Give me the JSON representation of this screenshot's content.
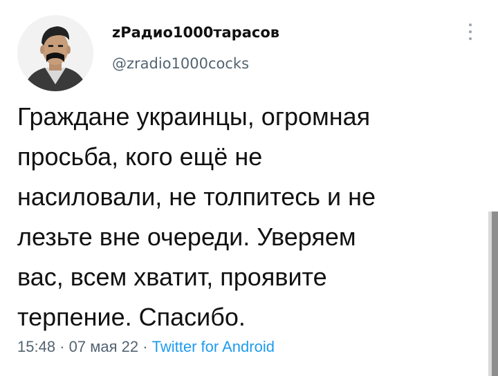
{
  "author": {
    "display_name": "zРадио1000тарасов",
    "handle": "@zradio1000cocks"
  },
  "tweet": {
    "text": "Граждане украинцы, огромная\nпросьба, кого ещё не\nнасиловали, не толпитесь и не\nлезьте вне очереди. Уверяем\nвас, всем хватит, проявите\nтерпение. Спасибо."
  },
  "meta": {
    "time": "15:48",
    "separator": " · ",
    "date": "07 мая 22",
    "source": "Twitter for Android"
  },
  "icons": {
    "more": "more-vertical-icon",
    "avatar": "avatar-image"
  },
  "colors": {
    "link": "#1d9bf0",
    "secondary_text": "#536471"
  }
}
